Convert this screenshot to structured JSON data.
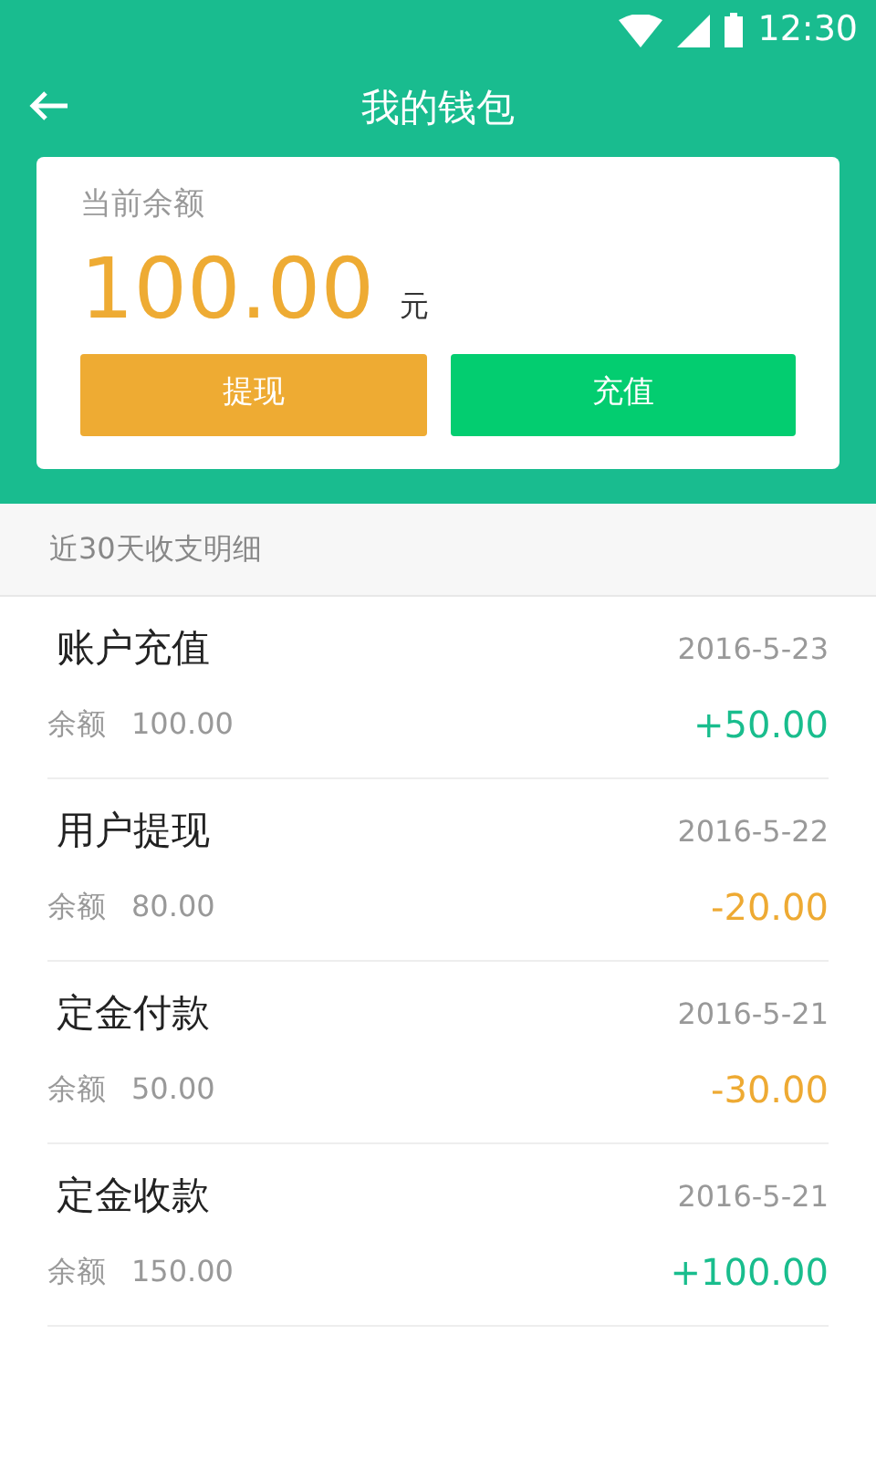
{
  "status_bar": {
    "time": "12:30"
  },
  "header": {
    "title": "我的钱包"
  },
  "balance_card": {
    "label": "当前余额",
    "amount": "100.00",
    "unit": "元",
    "buttons": [
      {
        "label": "提现",
        "kind": "withdraw"
      },
      {
        "label": "充值",
        "kind": "recharge"
      }
    ]
  },
  "section": {
    "title": "近30天收支明细"
  },
  "transactions": [
    {
      "title": "账户充值",
      "date": "2016-5-23",
      "balance_label": "余额",
      "balance": "100.00",
      "amount": "+50.00",
      "kind": "income"
    },
    {
      "title": "用户提现",
      "date": "2016-5-22",
      "balance_label": "余额",
      "balance": "80.00",
      "amount": "-20.00",
      "kind": "expense"
    },
    {
      "title": "定金付款",
      "date": "2016-5-21",
      "balance_label": "余额",
      "balance": "50.00",
      "amount": "-30.00",
      "kind": "expense"
    },
    {
      "title": "定金收款",
      "date": "2016-5-21",
      "balance_label": "余额",
      "balance": "150.00",
      "amount": "+100.00",
      "kind": "income"
    }
  ]
}
